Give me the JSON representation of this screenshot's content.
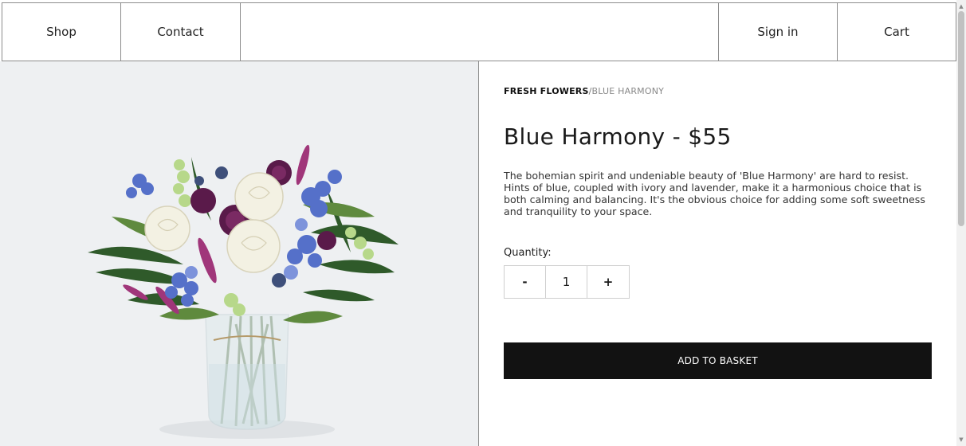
{
  "nav": {
    "shop": "Shop",
    "contact": "Contact",
    "signin": "Sign in",
    "cart": "Cart"
  },
  "breadcrumb": {
    "category": "FRESH FLOWERS",
    "separator": "/",
    "current": "BLUE HARMONY"
  },
  "product": {
    "title": "Blue Harmony - $55",
    "description": "The bohemian spirit and undeniable beauty of 'Blue Harmony' are hard to resist. Hints of blue, coupled with ivory and lavender, make it a harmonious choice that is both calming and balancing. It's the obvious choice for adding some soft sweetness and tranquility to your space.",
    "image_alt": "Blue Harmony bouquet in a glass vase"
  },
  "quantity": {
    "label": "Quantity:",
    "minus": "-",
    "value": "1",
    "plus": "+"
  },
  "actions": {
    "add_to_basket": "ADD TO BASKET"
  },
  "icons": {
    "scroll_up": "triangle-up-icon",
    "scroll_down": "triangle-down-icon"
  },
  "colors": {
    "button_bg": "#121212",
    "image_bg": "#eef0f2"
  }
}
